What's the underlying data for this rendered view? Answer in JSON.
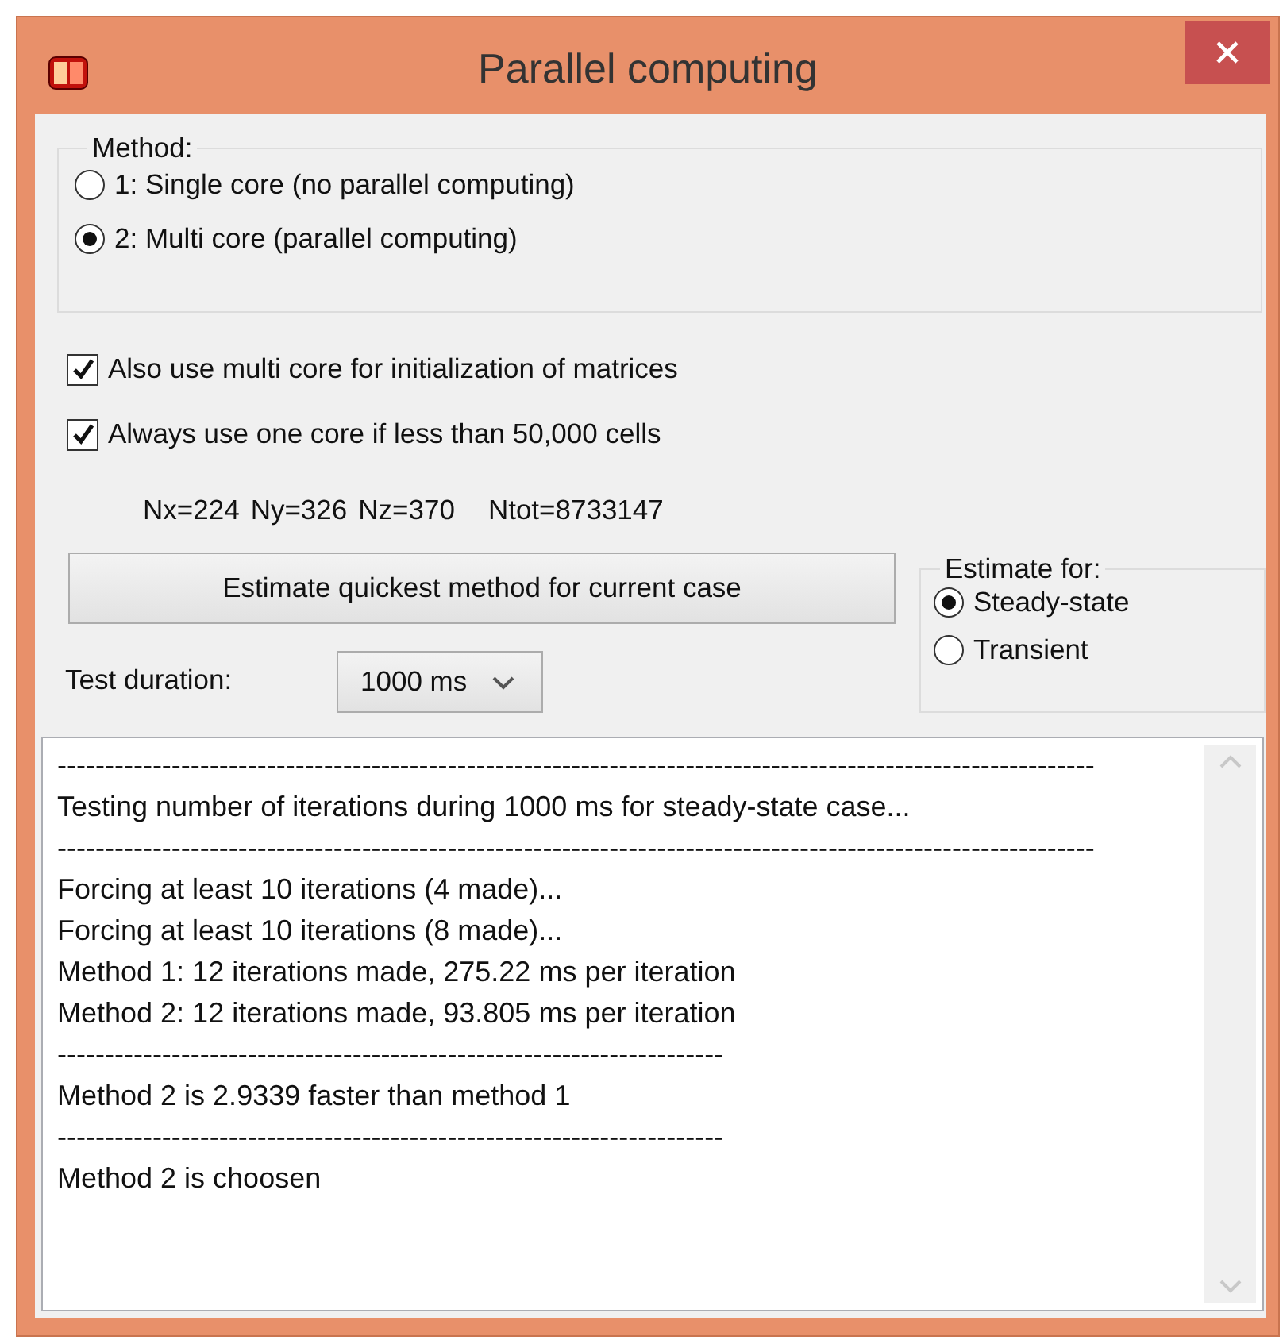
{
  "window": {
    "title": "Parallel computing"
  },
  "method": {
    "label": "Method:",
    "options": [
      {
        "label": "1: Single core (no parallel computing)",
        "selected": false
      },
      {
        "label": "2: Multi core (parallel computing)",
        "selected": true
      }
    ]
  },
  "options": [
    {
      "label": "Also use multi core for initialization of matrices",
      "checked": true
    },
    {
      "label": "Always use one core if less than 50,000 cells",
      "checked": true
    }
  ],
  "grid_info": [
    "Nx=224",
    "Ny=326",
    "Nz=370",
    "Ntot=8733147"
  ],
  "estimate_button": "Estimate quickest method for current case",
  "test_duration": {
    "label": "Test duration:",
    "value": "1000 ms"
  },
  "estimate_for": {
    "label": "Estimate for:",
    "options": [
      {
        "label": "Steady-state",
        "selected": true
      },
      {
        "label": "Transient",
        "selected": false
      }
    ]
  },
  "log": {
    "lines": [
      "-------------------------------------------------------------------------------------------------------------",
      "Testing number of iterations during 1000 ms for steady-state case...",
      "-------------------------------------------------------------------------------------------------------------",
      "Forcing at least 10 iterations (4 made)...",
      "Forcing at least 10 iterations (8 made)...",
      "Method 1: 12 iterations made, 275.22 ms per iteration",
      "Method 2: 12 iterations made, 93.805 ms per iteration",
      "----------------------------------------------------------------------",
      "Method 2 is 2.9339 faster than method 1",
      "----------------------------------------------------------------------",
      "Method 2 is choosen"
    ]
  }
}
